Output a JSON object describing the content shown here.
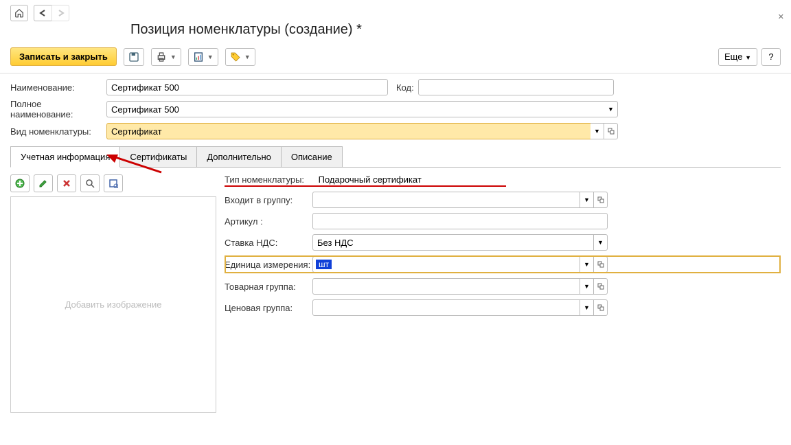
{
  "nav": {
    "home_icon": "home",
    "back_icon": "arrow-left",
    "fwd_icon": "arrow-right"
  },
  "title": "Позиция номенклатуры (создание) *",
  "toolbar": {
    "save_close": "Записать и закрыть",
    "more": "Еще",
    "help": "?"
  },
  "labels": {
    "name": "Наименование:",
    "full_name": "Полное наименование:",
    "kind": "Вид номенклатуры:",
    "code": "Код:",
    "add_image": "Добавить изображение"
  },
  "values": {
    "name": "Сертификат 500",
    "full_name": "Сертификат 500",
    "kind": "Сертификат",
    "code": ""
  },
  "tabs": {
    "t1": "Учетная информация",
    "t2": "Сертификаты",
    "t3": "Дополнительно",
    "t4": "Описание"
  },
  "props": {
    "type_lbl": "Тип номенклатуры:",
    "type_val": "Подарочный сертификат",
    "group_lbl": "Входит в группу:",
    "group_val": "",
    "article_lbl": "Артикул :",
    "article_val": "",
    "vat_lbl": "Ставка НДС:",
    "vat_val": "Без НДС",
    "unit_lbl": "Единица измерения:",
    "unit_val": "шт",
    "prod_group_lbl": "Товарная группа:",
    "prod_group_val": "",
    "price_group_lbl": "Ценовая группа:",
    "price_group_val": ""
  }
}
